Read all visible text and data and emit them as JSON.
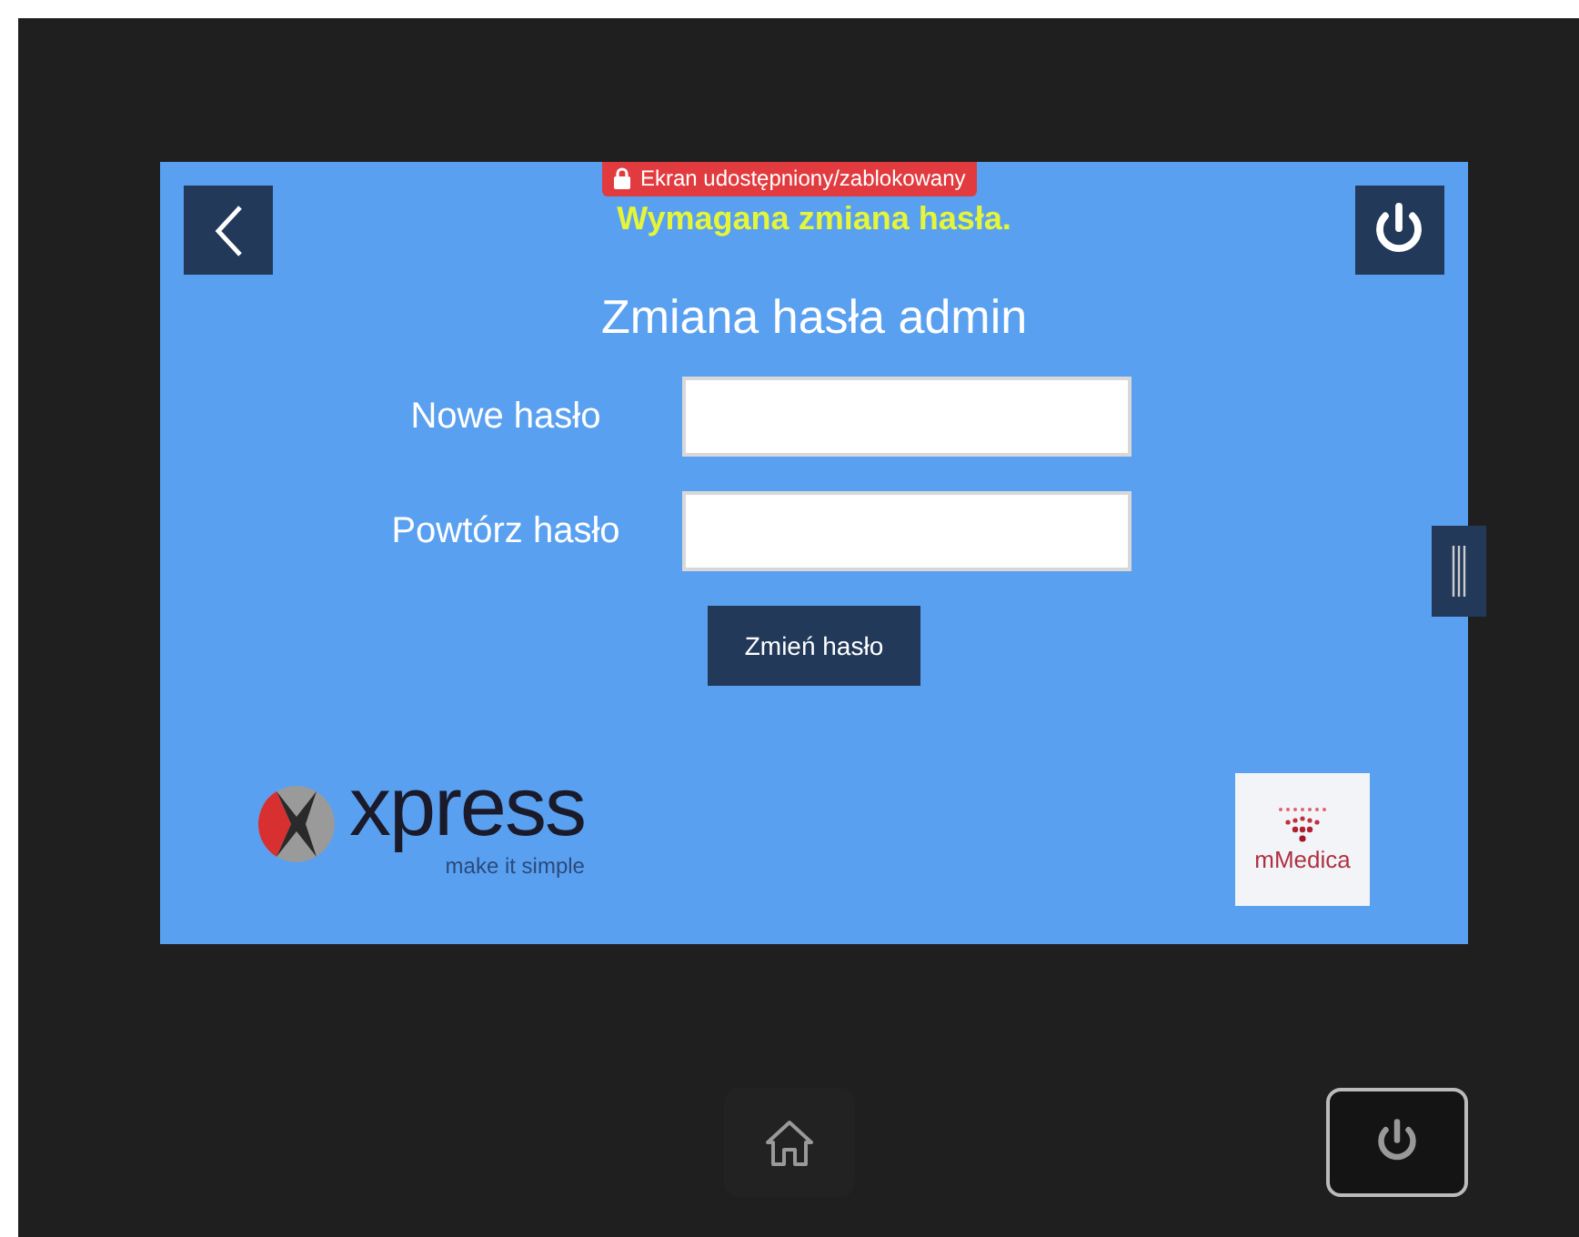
{
  "screen": {
    "notice": "Wymagana zmiana hasła.",
    "share_badge": "Ekran udostępniony/zablokowany",
    "heading": "Zmiana hasła admin",
    "fields": [
      {
        "label": "Nowe hasło"
      },
      {
        "label": "Powtórz hasło"
      }
    ],
    "submit_button": "Zmień hasło",
    "logos": {
      "xpress": {
        "name": "xpress",
        "tagline": "make it simple"
      },
      "mmedica": {
        "name": "mMedica"
      }
    }
  }
}
